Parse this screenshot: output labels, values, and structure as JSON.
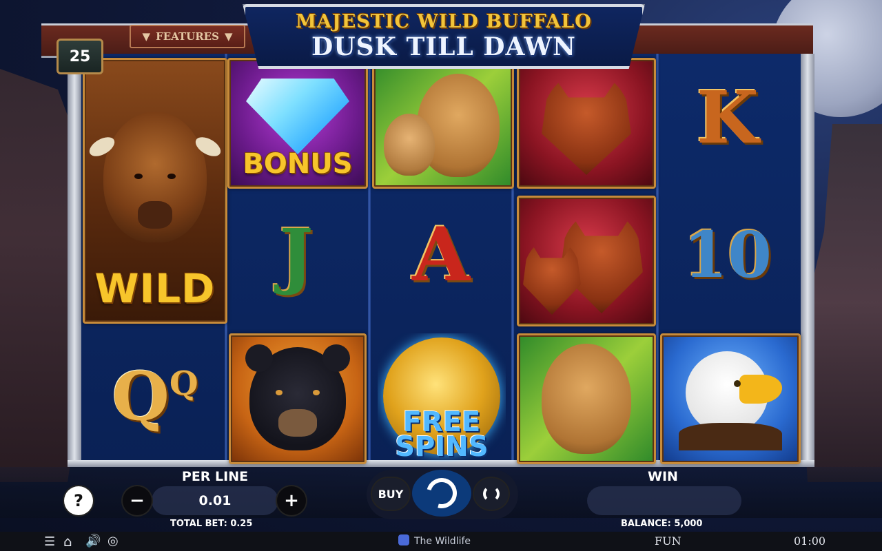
{
  "game": {
    "title_line1": "MAJESTIC WILD BUFFALO",
    "title_line2": "DUSK TILL DAWN",
    "features_label": "FEATURES",
    "lines_count": "25"
  },
  "reels": {
    "symbols": [
      {
        "reel": 1,
        "name": "buffalo-wild",
        "label": "WILD"
      },
      {
        "reel": 1,
        "name": "queen",
        "label": "Q"
      },
      {
        "reel": 2,
        "name": "diamond-bonus",
        "label": "BONUS"
      },
      {
        "reel": 2,
        "name": "jack",
        "label": "J"
      },
      {
        "reel": 2,
        "name": "bear",
        "label": ""
      },
      {
        "reel": 3,
        "name": "cougars",
        "label": ""
      },
      {
        "reel": 3,
        "name": "ace",
        "label": "A"
      },
      {
        "reel": 3,
        "name": "free-spins",
        "label_line1": "FREE",
        "label_line2": "SPINS"
      },
      {
        "reel": 4,
        "name": "wolf",
        "label": ""
      },
      {
        "reel": 4,
        "name": "wolves",
        "label": ""
      },
      {
        "reel": 4,
        "name": "cougar",
        "label": ""
      },
      {
        "reel": 5,
        "name": "king",
        "label": "K"
      },
      {
        "reel": 5,
        "name": "ten",
        "label": "10"
      },
      {
        "reel": 5,
        "name": "eagle",
        "label": ""
      }
    ],
    "wild_label": "WILD",
    "bonus_label": "BONUS",
    "free_label": "FREE",
    "spins_label": "SPINS",
    "jack_label": "J",
    "ace_label": "A",
    "king_label": "K",
    "ten_label": "10",
    "queen_label": "Q",
    "queen_small_label": "Q"
  },
  "controls": {
    "help_label": "?",
    "per_line_label": "PER LINE",
    "minus_label": "−",
    "per_line_value": "0.01",
    "plus_label": "+",
    "buy_label": "BUY",
    "win_label": "WIN",
    "win_value": "",
    "total_bet_text": "TOTAL BET: 0.25",
    "balance_text": "BALANCE: 5,000"
  },
  "footer": {
    "brand": "The Wildlife",
    "mode": "FUN",
    "clock": "01:00"
  },
  "colors": {
    "reel_bg": "#0b2560",
    "gold": "#f7c52b",
    "frame_red": "#6b2a1f"
  }
}
